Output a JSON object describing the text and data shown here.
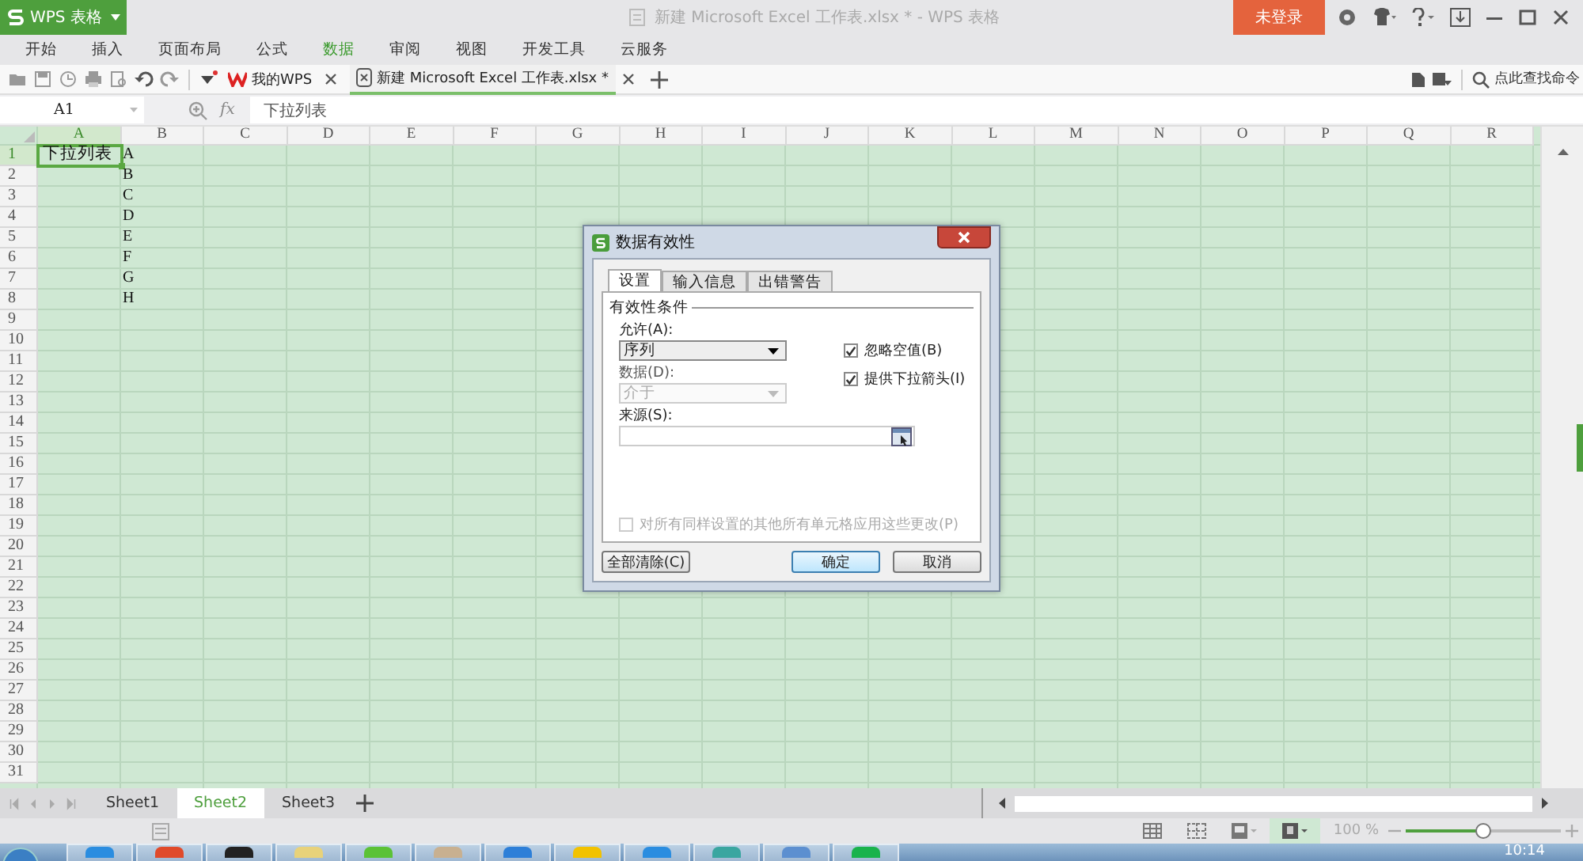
{
  "app_button": {
    "label": "WPS 表格"
  },
  "window": {
    "title": "新建 Microsoft Excel 工作表.xlsx * - WPS 表格"
  },
  "login_button": {
    "label": "未登录"
  },
  "ribbon_tabs": [
    {
      "label": "开始",
      "selected": false
    },
    {
      "label": "插入",
      "selected": false
    },
    {
      "label": "页面布局",
      "selected": false
    },
    {
      "label": "公式",
      "selected": false
    },
    {
      "label": "数据",
      "selected": true
    },
    {
      "label": "审阅",
      "selected": false
    },
    {
      "label": "视图",
      "selected": false
    },
    {
      "label": "开发工具",
      "selected": false
    },
    {
      "label": "云服务",
      "selected": false
    }
  ],
  "doc_tabs": [
    {
      "label": "我的WPS",
      "selected": false
    },
    {
      "label": "新建 Microsoft Excel 工作表.xlsx *",
      "selected": true
    }
  ],
  "command_search": {
    "placeholder": "点此查找命令"
  },
  "formula_bar": {
    "cell_ref": "A1",
    "function_label": "fx",
    "value": "下拉列表"
  },
  "sheet": {
    "columns": [
      {
        "label": "A",
        "selected": true
      },
      {
        "label": "B",
        "selected": false
      },
      {
        "label": "C",
        "selected": false
      },
      {
        "label": "D",
        "selected": false
      },
      {
        "label": "E",
        "selected": false
      },
      {
        "label": "F",
        "selected": false
      },
      {
        "label": "G",
        "selected": false
      },
      {
        "label": "H",
        "selected": false
      },
      {
        "label": "I",
        "selected": false
      },
      {
        "label": "J",
        "selected": false
      },
      {
        "label": "K",
        "selected": false
      },
      {
        "label": "L",
        "selected": false
      },
      {
        "label": "M",
        "selected": false
      },
      {
        "label": "N",
        "selected": false
      },
      {
        "label": "O",
        "selected": false
      },
      {
        "label": "P",
        "selected": false
      },
      {
        "label": "Q",
        "selected": false
      },
      {
        "label": "R",
        "selected": false
      }
    ],
    "rows": [
      {
        "label": "1",
        "selected": true,
        "cells": [
          "下拉列表",
          "A"
        ]
      },
      {
        "label": "2",
        "selected": false,
        "cells": [
          "",
          "B"
        ]
      },
      {
        "label": "3",
        "selected": false,
        "cells": [
          "",
          "C"
        ]
      },
      {
        "label": "4",
        "selected": false,
        "cells": [
          "",
          "D"
        ]
      },
      {
        "label": "5",
        "selected": false,
        "cells": [
          "",
          "E"
        ]
      },
      {
        "label": "6",
        "selected": false,
        "cells": [
          "",
          "F"
        ]
      },
      {
        "label": "7",
        "selected": false,
        "cells": [
          "",
          "G"
        ]
      },
      {
        "label": "8",
        "selected": false,
        "cells": [
          "",
          "H"
        ]
      },
      {
        "label": "9",
        "selected": false
      },
      {
        "label": "10",
        "selected": false
      },
      {
        "label": "11",
        "selected": false
      },
      {
        "label": "12",
        "selected": false
      },
      {
        "label": "13",
        "selected": false
      },
      {
        "label": "14",
        "selected": false
      },
      {
        "label": "15",
        "selected": false
      },
      {
        "label": "16",
        "selected": false
      },
      {
        "label": "17",
        "selected": false
      },
      {
        "label": "18",
        "selected": false
      },
      {
        "label": "19",
        "selected": false
      },
      {
        "label": "20",
        "selected": false
      },
      {
        "label": "21",
        "selected": false
      },
      {
        "label": "22",
        "selected": false
      },
      {
        "label": "23",
        "selected": false
      },
      {
        "label": "24",
        "selected": false
      },
      {
        "label": "25",
        "selected": false
      },
      {
        "label": "26",
        "selected": false
      },
      {
        "label": "27",
        "selected": false
      },
      {
        "label": "28",
        "selected": false
      },
      {
        "label": "29",
        "selected": false
      },
      {
        "label": "30",
        "selected": false
      },
      {
        "label": "31",
        "selected": false
      }
    ]
  },
  "dialog": {
    "title": "数据有效性",
    "tabs": [
      {
        "label": "设置",
        "selected": true
      },
      {
        "label": "输入信息",
        "selected": false
      },
      {
        "label": "出错警告",
        "selected": false
      }
    ],
    "section_title": "有效性条件",
    "allow": {
      "label": "允许(A):",
      "value": "序列",
      "disabled": false
    },
    "data": {
      "label": "数据(D):",
      "value": "介于",
      "disabled": true
    },
    "source": {
      "label": "来源(S):"
    },
    "checkboxes": [
      {
        "label": "忽略空值(B)",
        "checked": true,
        "disabled": false
      },
      {
        "label": "提供下拉箭头(I)",
        "checked": true,
        "disabled": false
      }
    ],
    "apply_all": {
      "label": "对所有同样设置的其他所有单元格应用这些更改(P)",
      "checked": false,
      "disabled": true
    },
    "buttons": [
      {
        "label": "全部清除(C)",
        "kind": "secondary"
      },
      {
        "label": "确定",
        "kind": "default"
      },
      {
        "label": "取消",
        "kind": "secondary"
      }
    ]
  },
  "sheet_tabs": [
    {
      "label": "Sheet1",
      "selected": false
    },
    {
      "label": "Sheet2",
      "selected": true
    },
    {
      "label": "Sheet3",
      "selected": false
    }
  ],
  "zoom": {
    "reading": "100 %",
    "level": 0.5
  },
  "taskbar": {
    "clock": "10:14"
  }
}
